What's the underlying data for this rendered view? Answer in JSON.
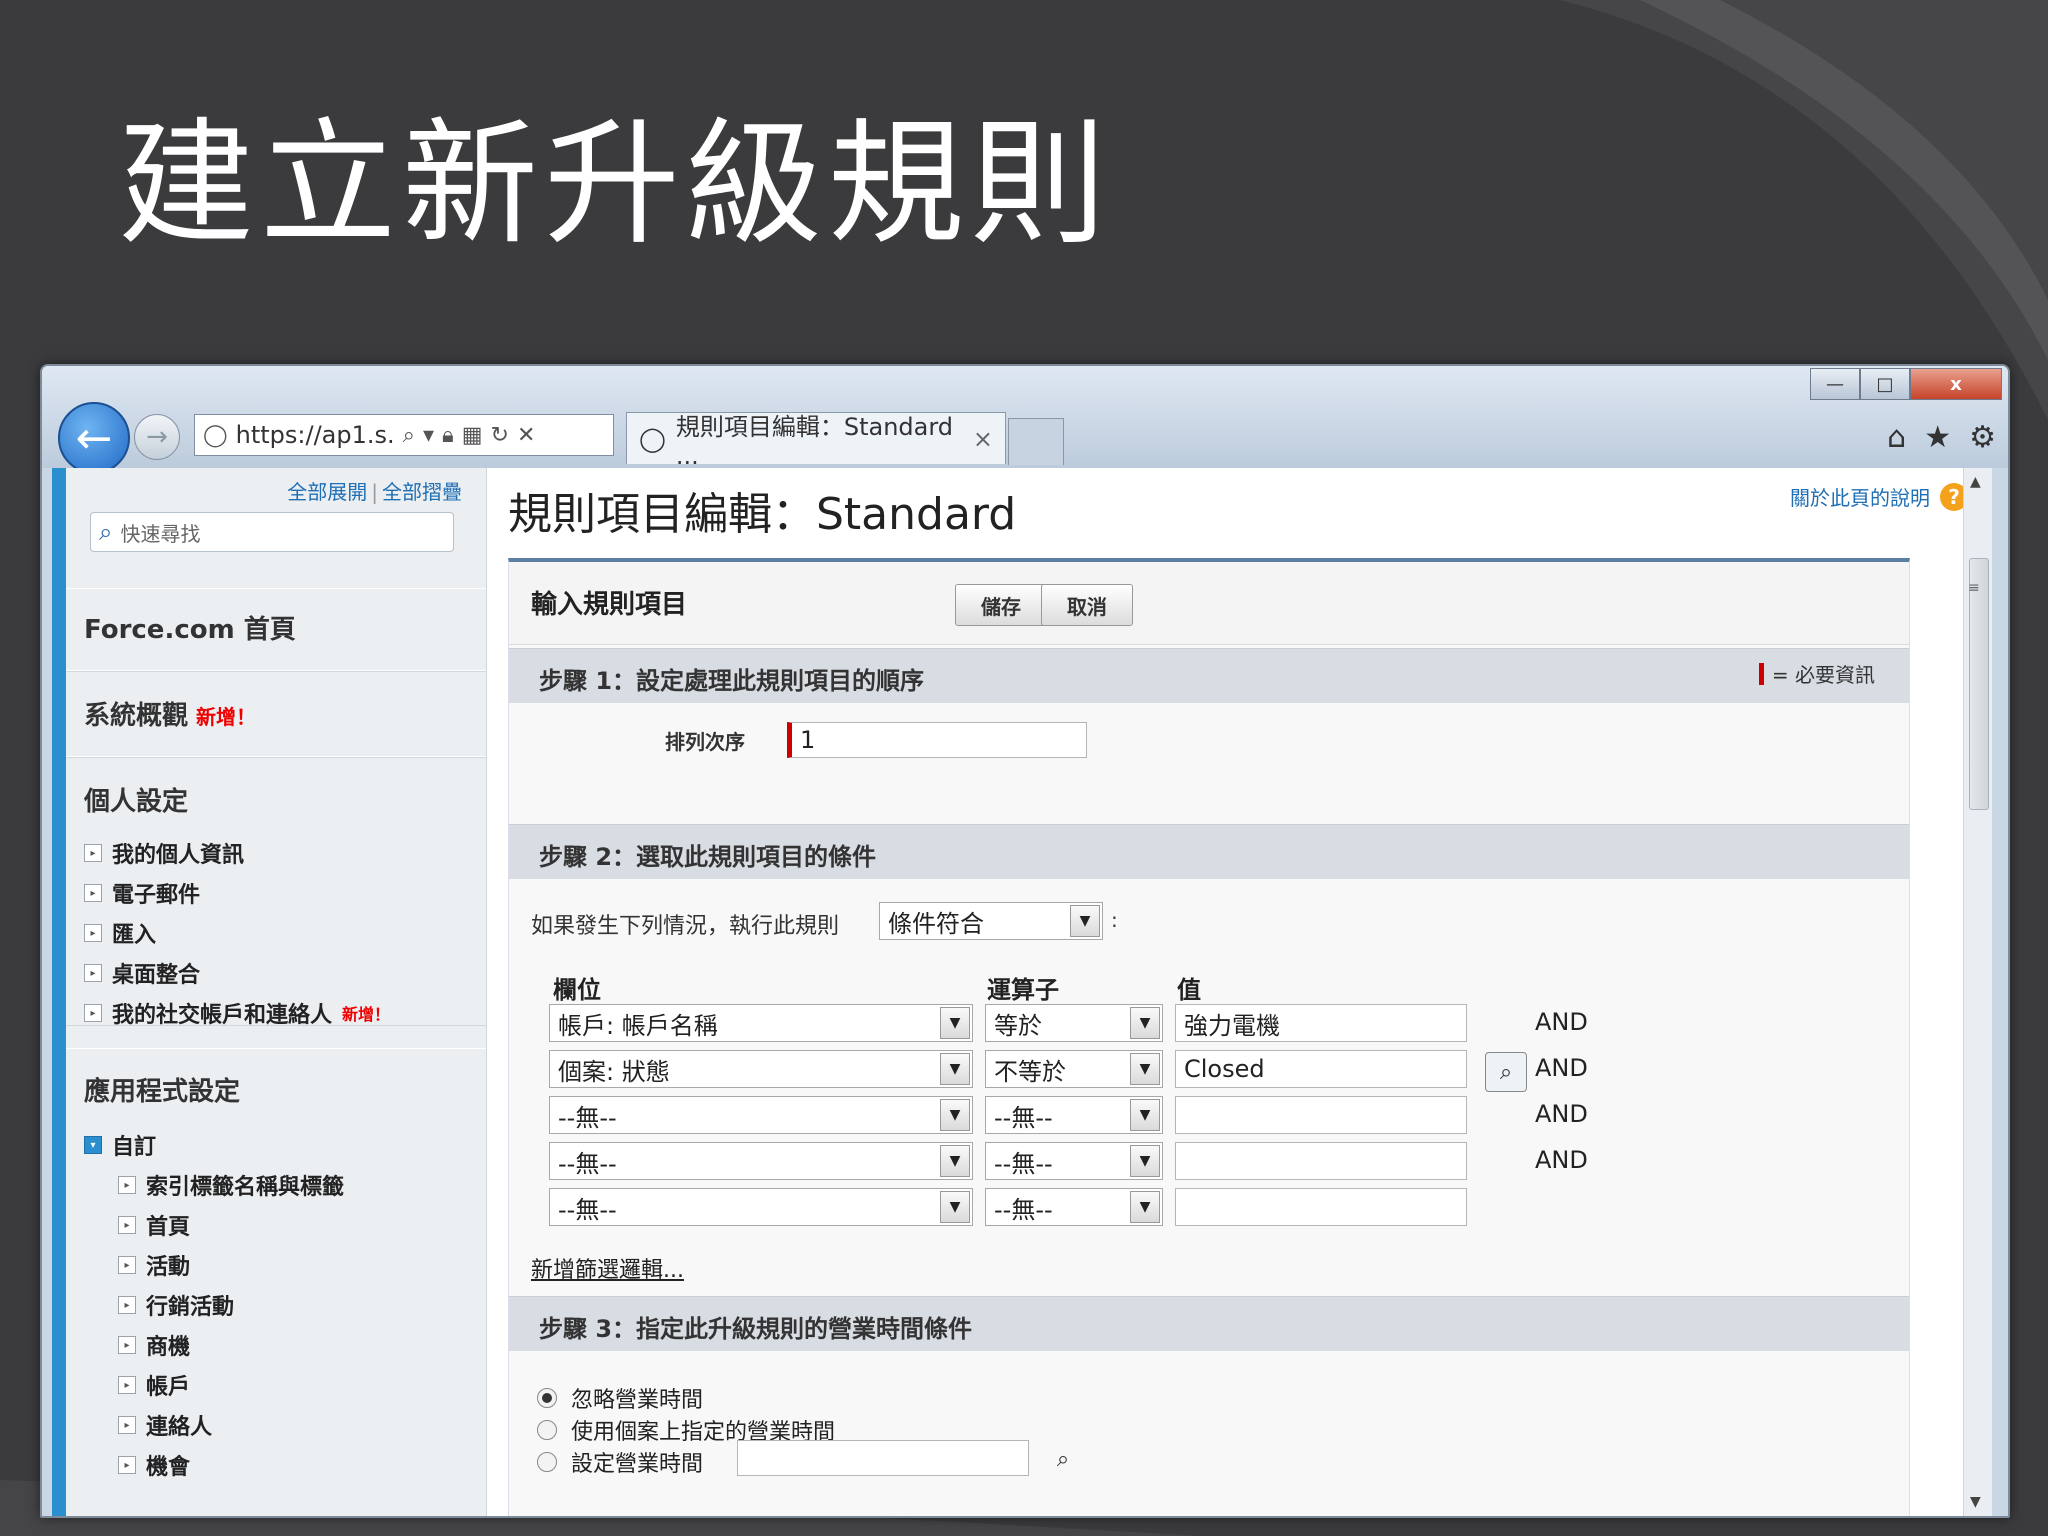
{
  "slide": {
    "title": "建立新升級規則"
  },
  "browser": {
    "address": "https://ap1.s.",
    "tab_title": "規則項目編輯：Standard ...",
    "tab_close": "×",
    "win_minimize": "—",
    "win_maximize": "□",
    "win_close": "x"
  },
  "sidebar": {
    "expand_all": "全部展開",
    "collapse_all": "全部摺疊",
    "search_placeholder": "快速尋找",
    "force_home": "Force.com 首頁",
    "system_overview": "系統概觀",
    "new_badge": "新增！",
    "personal_setup": "個人設定",
    "personal_items": [
      "我的個人資訊",
      "電子郵件",
      "匯入",
      "桌面整合",
      "我的社交帳戶和連絡人"
    ],
    "personal_new_badge": "新增！",
    "app_setup": "應用程式設定",
    "customize": "自訂",
    "customize_items": [
      "索引標籤名稱與標籤",
      "首頁",
      "活動",
      "行銷活動",
      "商機",
      "帳戶",
      "連絡人",
      "機會"
    ]
  },
  "main": {
    "page_title": "規則項目編輯：Standard",
    "help_link": "關於此頁的說明",
    "panel_title": "輸入規則項目",
    "save": "儲存",
    "cancel": "取消",
    "required_info": "= 必要資訊",
    "step1_title": "步驟 1：設定處理此規則項目的順序",
    "sort_order_label": "排列次序",
    "sort_order_value": "1",
    "step2_title": "步驟 2：選取此規則項目的條件",
    "criteria_prefix": "如果發生下列情況，執行此規則",
    "criteria_value": "條件符合",
    "criteria_suffix": ":",
    "col_field": "欄位",
    "col_operator": "運算子",
    "col_value": "值",
    "rows": [
      {
        "field": "帳戶: 帳戶名稱",
        "operator": "等於",
        "value": "強力電機",
        "and": "AND"
      },
      {
        "field": "個案: 狀態",
        "operator": "不等於",
        "value": "Closed",
        "and": "AND"
      },
      {
        "field": "--無--",
        "operator": "--無--",
        "value": "",
        "and": "AND"
      },
      {
        "field": "--無--",
        "operator": "--無--",
        "value": "",
        "and": "AND"
      },
      {
        "field": "--無--",
        "operator": "--無--",
        "value": "",
        "and": ""
      }
    ],
    "add_filter_logic": "新增篩選邏輯...",
    "step3_title": "步驟 3：指定此升級規則的營業時間條件",
    "radio_options": [
      "忽略營業時間",
      "使用個案上指定的營業時間",
      "設定營業時間"
    ]
  }
}
